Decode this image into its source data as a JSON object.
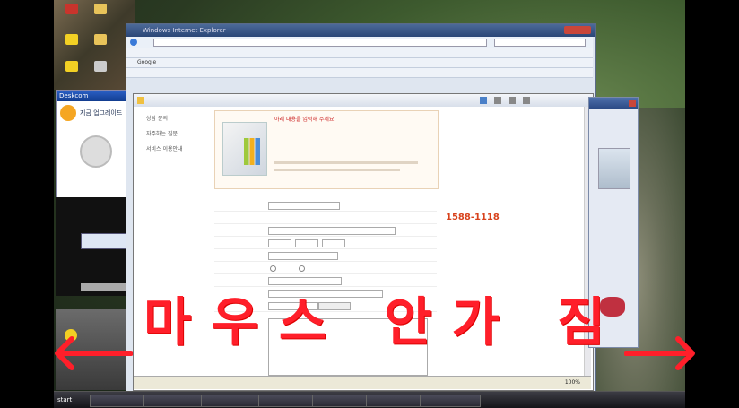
{
  "overlay": {
    "caption": "마우스 안가 짐"
  },
  "ie_back": {
    "title": "Windows Internet Explorer",
    "toolbar_rows": [
      "Google",
      "",
      ""
    ]
  },
  "ie_front": {
    "status_zone": "100%"
  },
  "left_nav": {
    "items": [
      "상담 문의",
      "자주하는 질문",
      "서비스 이용안내"
    ]
  },
  "banner": {
    "heading": "마우스 안가 짐",
    "notices": [
      "아래 내용을 입력해 주세요.",
      "",
      "",
      ""
    ]
  },
  "form": {
    "labels": [
      "",
      "",
      "",
      "",
      "",
      "",
      "",
      "",
      "",
      ""
    ],
    "email_domain": "",
    "select_value": ""
  },
  "side_panel": {
    "phone": "1588-1118",
    "lines": [
      "",
      "",
      ""
    ]
  },
  "desktop": {
    "deskcom_title": "Deskcom",
    "deskcom_text": "지금 업그레이드",
    "icons": [
      "",
      "",
      "",
      "",
      "",
      ""
    ]
  },
  "taskbar": {
    "start_label": "start",
    "tasks": [
      "",
      "",
      "",
      "",
      "",
      "",
      ""
    ],
    "clock": ""
  },
  "colors": {
    "overlay_red": "#ff1f2a",
    "phone_orange": "#d8421c",
    "taskbar": "#1f1f26"
  }
}
